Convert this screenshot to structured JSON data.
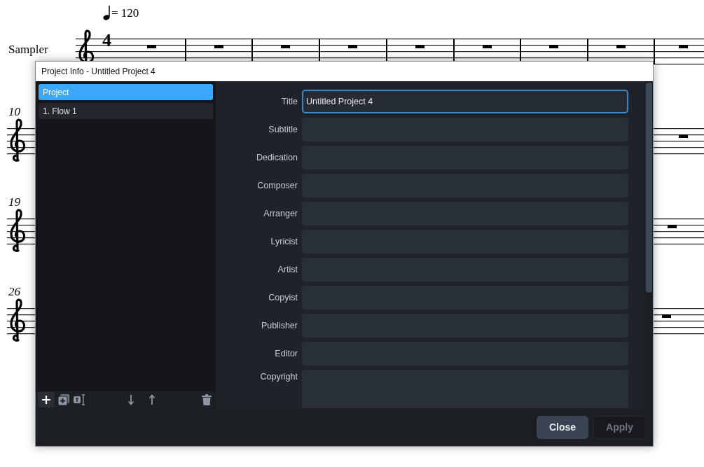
{
  "score": {
    "tempo": "= 120",
    "instrument": "Sampler",
    "time_signature": "4",
    "systems": [
      {
        "measure_number": "10"
      },
      {
        "measure_number": "19"
      },
      {
        "measure_number": "26"
      }
    ]
  },
  "dialog": {
    "title": "Project Info - Untitled Project 4",
    "sidebar": {
      "items": [
        {
          "label": "Project",
          "selected": true
        },
        {
          "label": "1. Flow 1",
          "selected": false
        }
      ]
    },
    "fields": [
      {
        "label": "Title",
        "value": "Untitled Project 4",
        "kind": "line",
        "focused": true
      },
      {
        "label": "Subtitle",
        "kind": "line",
        "focused": false
      },
      {
        "label": "Dedication",
        "kind": "line",
        "focused": false
      },
      {
        "label": "Composer",
        "kind": "line",
        "focused": false
      },
      {
        "label": "Arranger",
        "kind": "line",
        "focused": false
      },
      {
        "label": "Lyricist",
        "kind": "line",
        "focused": false
      },
      {
        "label": "Artist",
        "kind": "line",
        "focused": false
      },
      {
        "label": "Copyist",
        "kind": "line",
        "focused": false
      },
      {
        "label": "Publisher",
        "kind": "line",
        "focused": false
      },
      {
        "label": "Editor",
        "kind": "line",
        "focused": false
      },
      {
        "label": "Copyright",
        "kind": "multiline",
        "focused": false
      }
    ],
    "buttons": [
      {
        "label": "Close",
        "disabled": false
      },
      {
        "label": "Apply",
        "disabled": true
      }
    ]
  }
}
